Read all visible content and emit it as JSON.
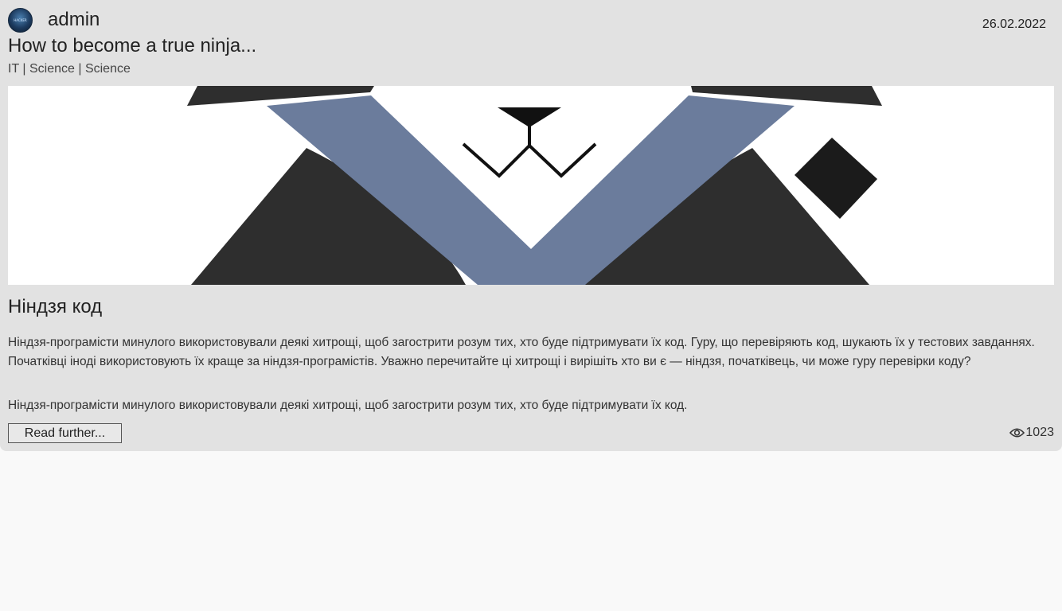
{
  "post": {
    "author": "admin",
    "avatar_text": "HACKER",
    "date": "26.02.2022",
    "title": "How to become a true ninja...",
    "categories": "IT | Science | Science",
    "subtitle": "Ніндзя код",
    "body": "Ніндзя-програмісти минулого використовували деякі хитрощі, щоб загострити розум тих, хто буде підтримувати їх код. Гуру, що перевіряють код, шукають їх у тестових завданнях. Початківці іноді використовують їх краще за ніндзя-програмістів. Уважно перечитайте ці хитрощі і вирішіть хто ви є — ніндзя, початківець, чи може гуру перевірки коду?",
    "excerpt": "Ніндзя-програмісти минулого використовували деякі хитрощі, щоб загострити розум тих, хто буде підтримувати їх код.",
    "read_more_label": "Read further...",
    "views": "1023"
  },
  "icons": {
    "eye": "eye-icon",
    "avatar": "avatar-image"
  },
  "colors": {
    "card_background": "#e2e2e2",
    "page_background": "#f9f9f9",
    "cover_blue": "#6b7c9c",
    "cover_dark": "#2e2e2e"
  }
}
